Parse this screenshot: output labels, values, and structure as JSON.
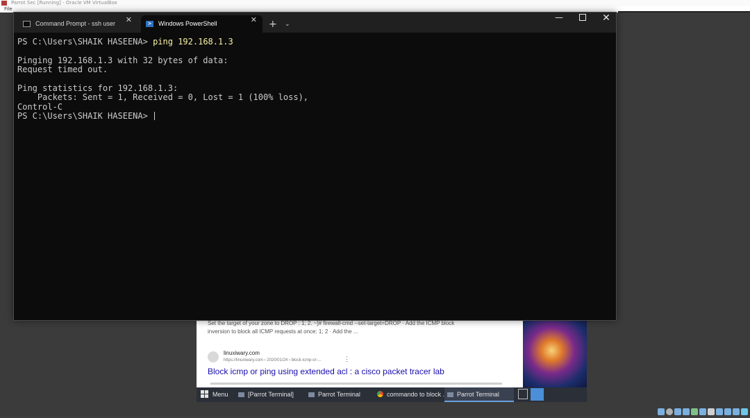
{
  "host": {
    "title": "Parrot Sec [Running] - Oracle VM VirtualBox",
    "menu_label": "File"
  },
  "browser": {
    "snippet_line1": "Set the target of your zone to DROP : 1; 2. ~]# firewall-cmd --set-target=DROP · Add the ICMP block",
    "snippet_line2": "inversion to block all ICMP requests at once: 1; 2 · Add the ...",
    "site_name": "linuxiwary.com",
    "site_url": "https://linuxiwary.com › 2020/01/24 › block-icmp-or-...",
    "result_title": "Block icmp or ping using extended acl : a cisco packet tracer lab"
  },
  "taskbar": {
    "menu_label": "Menu",
    "items": [
      {
        "label": "[Parrot Terminal]",
        "icon": "terminal-icon"
      },
      {
        "label": "Parrot Terminal",
        "icon": "terminal-icon"
      },
      {
        "label": "commando to block ...",
        "icon": "chrome-icon"
      },
      {
        "label": "Parrot Terminal",
        "icon": "terminal-icon",
        "active": true
      }
    ]
  },
  "terminal": {
    "tabs": [
      {
        "label": "Command Prompt - ssh  user",
        "icon": "cmd-icon",
        "active": false
      },
      {
        "label": "Windows PowerShell",
        "icon": "powershell-icon",
        "active": true
      }
    ],
    "new_tab_glyph": "+",
    "dropdown_glyph": "⌄",
    "window_controls": {
      "minimize": "—",
      "close": "✕"
    },
    "prompt": "PS C:\\Users\\SHAIK HASEENA> ",
    "command": "ping 192.168.1.3",
    "output_lines": [
      "",
      "Pinging 192.168.1.3 with 32 bytes of data:",
      "Request timed out.",
      "",
      "Ping statistics for 192.168.1.3:",
      "    Packets: Sent = 1, Received = 0, Lost = 1 (100% loss),",
      "Control-C"
    ],
    "final_prompt": "PS C:\\Users\\SHAIK HASEENA> "
  },
  "colors": {
    "terminal_bg": "#0c0c0c",
    "tabbar_bg": "#202020",
    "text": "#cccccc",
    "command": "#f9f1a5"
  }
}
